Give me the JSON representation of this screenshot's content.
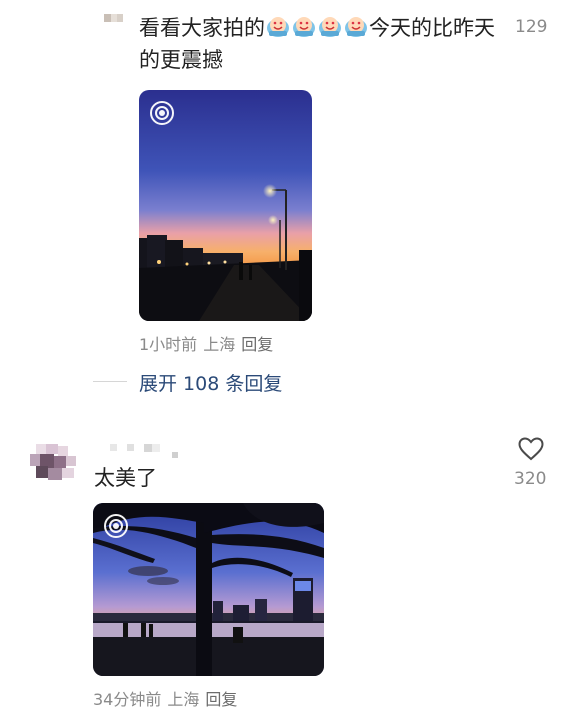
{
  "comment1": {
    "text_part1": "看看大家拍的",
    "emoji_count": 4,
    "emoji_name": "crying-laugh-emoji",
    "text_part2": "今天的比昨天",
    "text_line2": "的更震撼",
    "like_count": "129",
    "time": "1小时前",
    "location": "上海",
    "reply_label": "回复",
    "expand_label": "展开 108 条回复"
  },
  "comment2": {
    "text": "太美了",
    "like_count": "320",
    "time": "34分钟前",
    "location": "上海",
    "reply_label": "回复"
  },
  "icons": {
    "like": "heart-outline-icon",
    "live_photo": "live-photo-icon"
  },
  "colors": {
    "text_primary": "#222222",
    "text_meta": "#8a8a8a",
    "link_blue": "#2b4a78"
  }
}
